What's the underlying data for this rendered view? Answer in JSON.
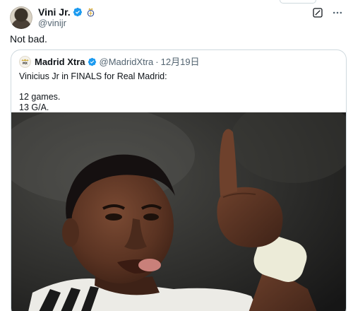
{
  "author": {
    "display_name": "Vini Jr.",
    "handle": "@vinijr",
    "verified_icon": "verified-badge-icon",
    "affiliate_icon": "real-madrid-crest-icon"
  },
  "tweet": {
    "text": "Not bad."
  },
  "quoted_tweet": {
    "author": {
      "display_name": "Madrid Xtra",
      "handle": "@MadridXtra",
      "avatar_label": "MX"
    },
    "separator": "·",
    "date": "12月19日",
    "text": "Vinicius Jr in FINALS for Real Madrid:\n\n12 games.\n13 G/A.",
    "media": {
      "description_icon": "photo-player-pointing-up"
    }
  },
  "colors": {
    "primary_text": "#0f1419",
    "secondary_text": "#536471",
    "border": "#cfd9de",
    "verified_blue": "#1d9bf0"
  },
  "icons": {
    "grok": "grok-icon",
    "more": "more-options-icon"
  }
}
